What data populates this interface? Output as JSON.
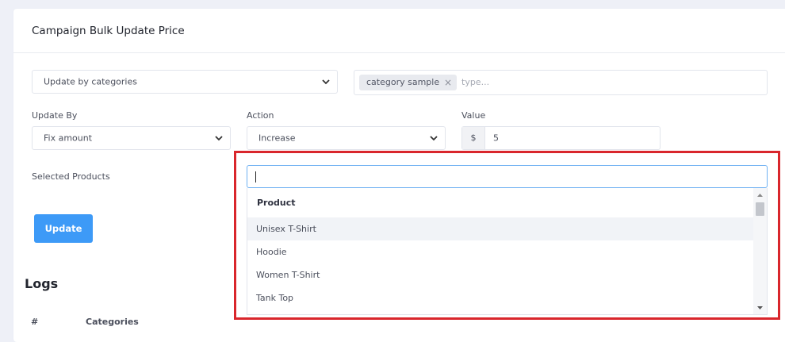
{
  "page": {
    "title": "Campaign Bulk Update Price"
  },
  "form": {
    "category_select_value": "Update by categories",
    "tag_label": "category sample",
    "tag_remove": "×",
    "tags_placeholder": "type...",
    "update_by_label": "Update By",
    "update_by_value": "Fix amount",
    "action_label": "Action",
    "action_value": "Increase",
    "value_label": "Value",
    "value_addon": "$",
    "value_amount": "5",
    "selected_products_label": "Selected Products",
    "update_button": "Update"
  },
  "dropdown": {
    "group_header": "Product",
    "options": [
      "Unisex T-Shirt",
      "Hoodie",
      "Women T-Shirt",
      "Tank Top"
    ],
    "hovered_index": 0
  },
  "logs": {
    "title": "Logs",
    "columns": [
      "#",
      "Categories"
    ]
  },
  "colors": {
    "accent": "#3d9af7",
    "highlight": "#d9262c",
    "focus_border": "#6fb1f2"
  }
}
